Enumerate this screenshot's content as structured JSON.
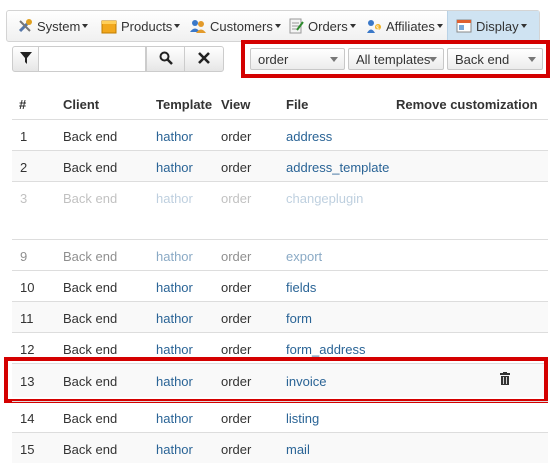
{
  "menu": {
    "system": "System",
    "products": "Products",
    "customers": "Customers",
    "orders": "Orders",
    "affiliates": "Affiliates",
    "display": "Display"
  },
  "filters": {
    "search_value": "",
    "view_select": "order",
    "template_select": "All templates",
    "client_select": "Back end"
  },
  "table": {
    "headers": {
      "num": "#",
      "client": "Client",
      "template": "Template",
      "view": "View",
      "file": "File",
      "remove": "Remove customization"
    },
    "rows": [
      {
        "num": "1",
        "client": "Back end",
        "template": "hathor",
        "view": "order",
        "file": "address"
      },
      {
        "num": "2",
        "client": "Back end",
        "template": "hathor",
        "view": "order",
        "file": "address_template"
      },
      {
        "num": "3",
        "client": "Back end",
        "template": "hathor",
        "view": "order",
        "file": "changeplugin"
      },
      {
        "num": "9",
        "client": "Back end",
        "template": "hathor",
        "view": "order",
        "file": "export"
      },
      {
        "num": "10",
        "client": "Back end",
        "template": "hathor",
        "view": "order",
        "file": "fields"
      },
      {
        "num": "11",
        "client": "Back end",
        "template": "hathor",
        "view": "order",
        "file": "form"
      },
      {
        "num": "12",
        "client": "Back end",
        "template": "hathor",
        "view": "order",
        "file": "form_address"
      },
      {
        "num": "13",
        "client": "Back end",
        "template": "hathor",
        "view": "order",
        "file": "invoice"
      },
      {
        "num": "14",
        "client": "Back end",
        "template": "hathor",
        "view": "order",
        "file": "listing"
      },
      {
        "num": "15",
        "client": "Back end",
        "template": "hathor",
        "view": "order",
        "file": "mail"
      }
    ]
  },
  "colors": {
    "highlight": "#d40000",
    "link": "#2a6496",
    "active_menu": "#cfe3f2"
  }
}
